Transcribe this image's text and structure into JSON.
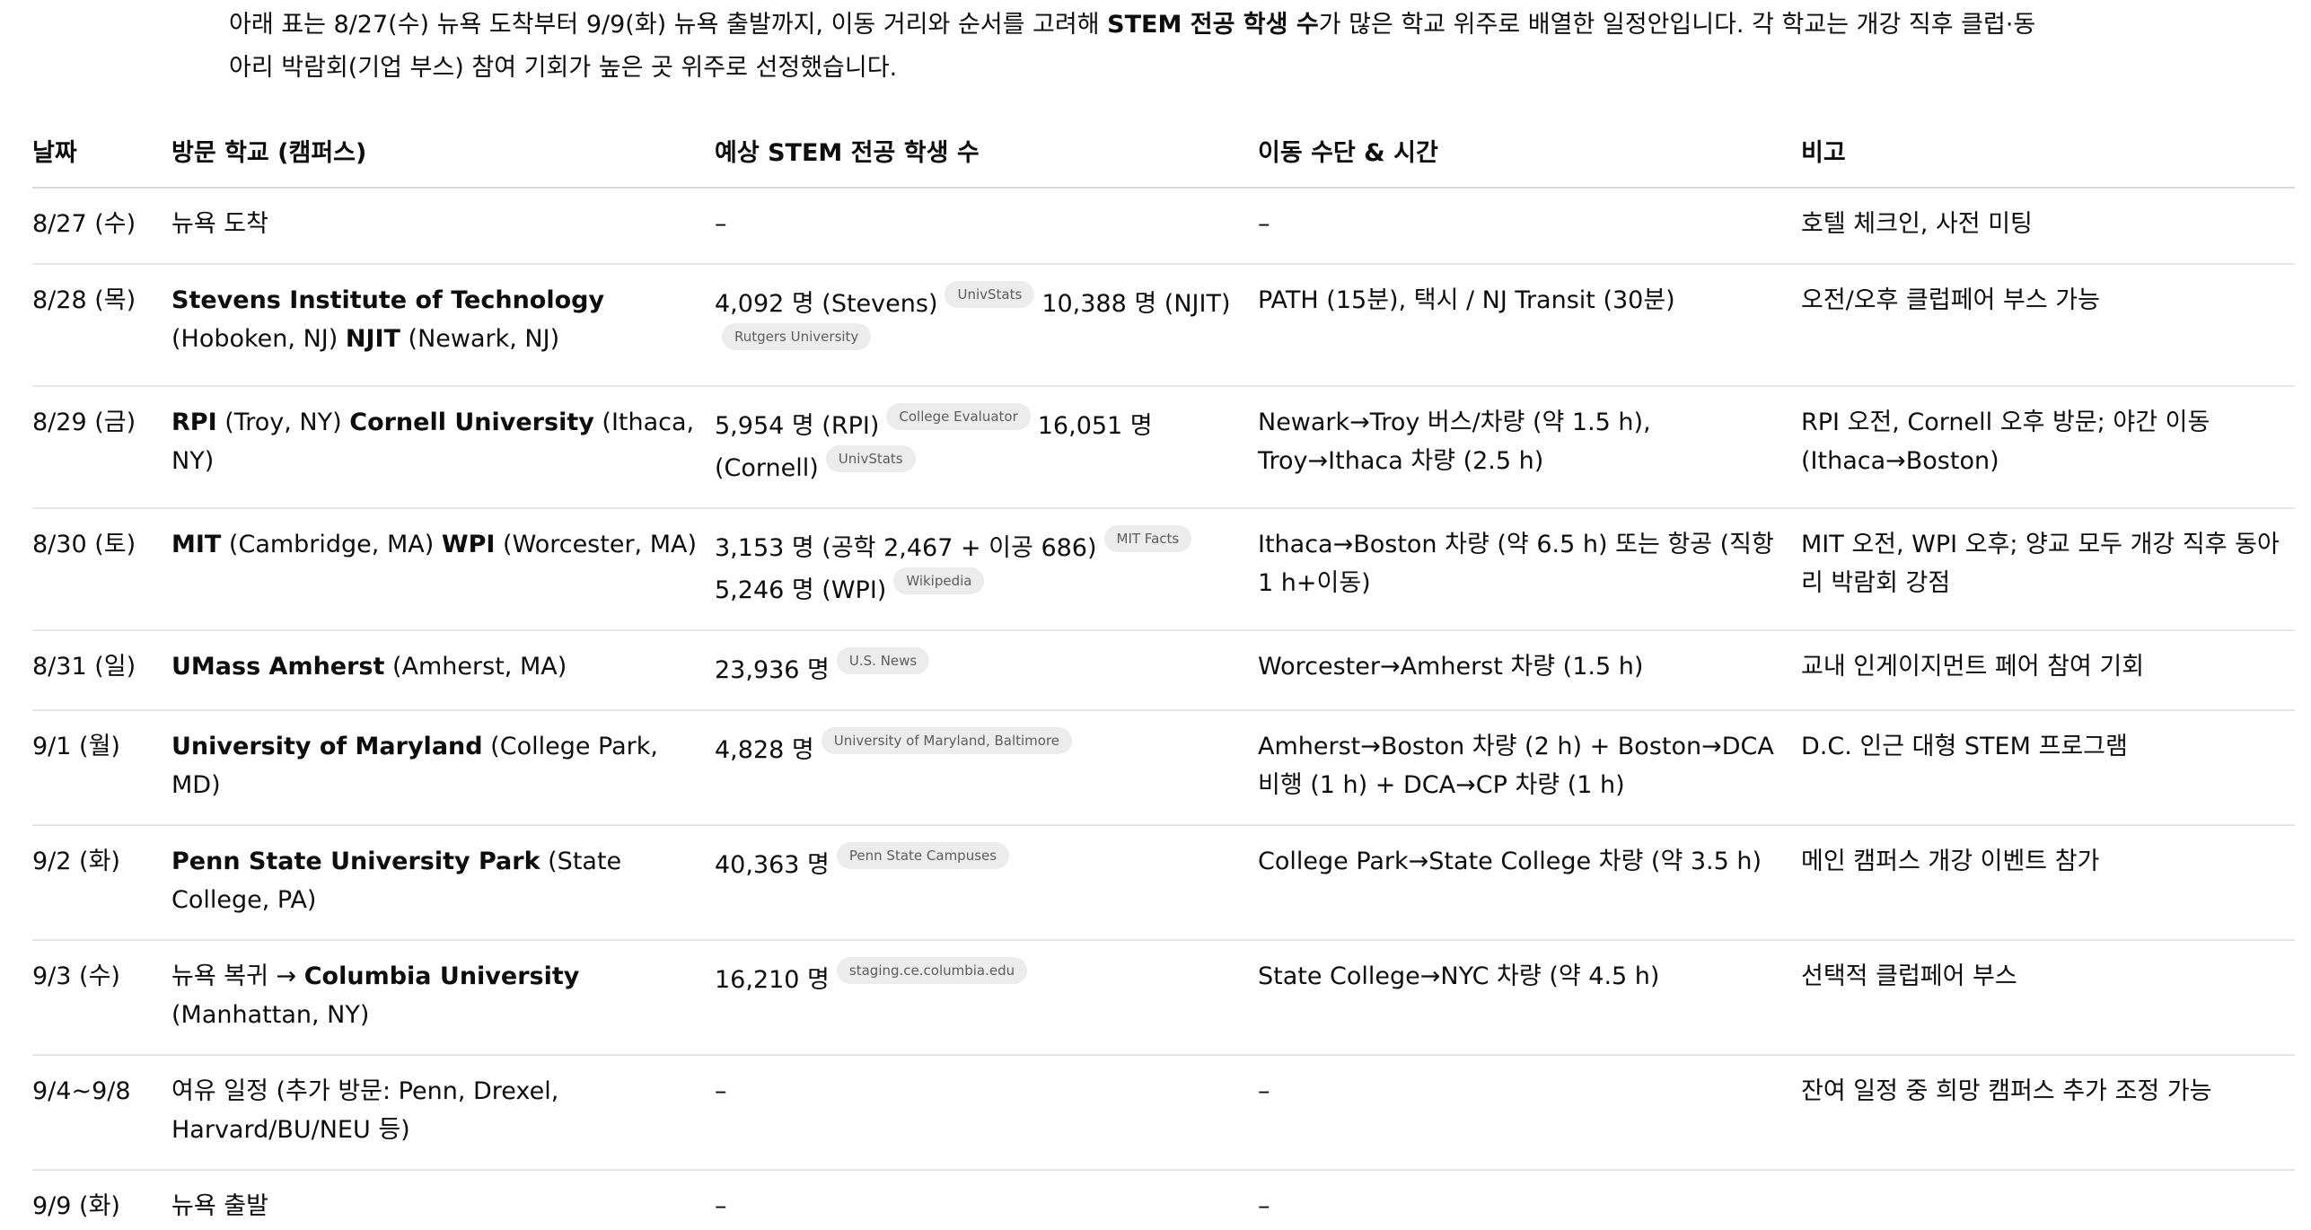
{
  "intro": {
    "p1": "아래 표는 8/27(수) 뉴욕 도착부터 9/9(화) 뉴욕 출발까지, 이동 거리와 순서를 고려해 ",
    "bold": "STEM 전공 학생 수",
    "p2": "가 많은 학교 위주로 배열한 일정안입니다. 각 학교는 개강 직후 클럽·동아리 박람회(기업 부스) 참여 기회가 높은 곳 위주로 선정했습니다."
  },
  "table": {
    "headers": [
      "날짜",
      "방문 학교 (캠퍼스)",
      "예상 STEM 전공 학생 수",
      "이동 수단 & 시간",
      "비고"
    ],
    "rows": [
      {
        "date": "8/27 (수)",
        "school": [
          {
            "plain": "뉴욕 도착"
          }
        ],
        "stem": [
          {
            "plain": "–"
          }
        ],
        "transport": "–",
        "note": "호텔 체크인, 사전 미팅"
      },
      {
        "date": "8/28 (목)",
        "school": [
          {
            "bold": "Stevens Institute of Technology",
            "plain": " (Hoboken, NJ) "
          },
          {
            "bold": "NJIT",
            "plain": " (Newark, NJ)"
          }
        ],
        "stem": [
          {
            "plain": "4,092 명 (Stevens)",
            "chip": "UnivStats"
          },
          {
            "plain": "10,388 명 (NJIT)",
            "chip": "Rutgers University"
          }
        ],
        "transport": "PATH (15분), 택시 / NJ Transit (30분)",
        "note": "오전/오후 클럽페어 부스 가능"
      },
      {
        "date": "8/29 (금)",
        "school": [
          {
            "bold": "RPI",
            "plain": " (Troy, NY) "
          },
          {
            "bold": "Cornell University",
            "plain": " (Ithaca, NY)"
          }
        ],
        "stem": [
          {
            "plain": "5,954 명 (RPI)",
            "chip": "College Evaluator"
          },
          {
            "plain": "16,051 명 (Cornell)",
            "chip": "UnivStats"
          }
        ],
        "transport": "Newark→Troy 버스/차량 (약 1.5 h), Troy→Ithaca 차량 (2.5 h)",
        "note": "RPI 오전, Cornell 오후 방문; 야간 이동 (Ithaca→Boston)"
      },
      {
        "date": "8/30 (토)",
        "school": [
          {
            "bold": "MIT",
            "plain": " (Cambridge, MA) "
          },
          {
            "bold": "WPI",
            "plain": " (Worcester, MA)"
          }
        ],
        "stem": [
          {
            "plain": "3,153 명 (공학 2,467 + 이공 686)",
            "chip": "MIT Facts"
          },
          {
            "plain": "5,246 명 (WPI)",
            "chip": "Wikipedia"
          }
        ],
        "transport": "Ithaca→Boston 차량 (약 6.5 h) 또는 항공 (직항 1 h+이동)",
        "note": "MIT 오전, WPI 오후; 양교 모두 개강 직후 동아리 박람회 강점"
      },
      {
        "date": "8/31 (일)",
        "school": [
          {
            "bold": "UMass Amherst",
            "plain": " (Amherst, MA)"
          }
        ],
        "stem": [
          {
            "plain": "23,936 명",
            "chip": "U.S. News"
          }
        ],
        "transport": "Worcester→Amherst 차량 (1.5 h)",
        "note": "교내 인게이지먼트 페어 참여 기회"
      },
      {
        "date": "9/1 (월)",
        "school": [
          {
            "bold": "University of Maryland",
            "plain": " (College Park, MD)"
          }
        ],
        "stem": [
          {
            "plain": "4,828 명",
            "chip": "University of Maryland, Baltimore"
          }
        ],
        "transport": "Amherst→Boston 차량 (2 h) + Boston→DCA 비행 (1 h) + DCA→CP 차량 (1 h)",
        "note": "D.C. 인근 대형 STEM 프로그램"
      },
      {
        "date": "9/2 (화)",
        "school": [
          {
            "bold": "Penn State University Park",
            "plain": " (State College, PA)"
          }
        ],
        "stem": [
          {
            "plain": "40,363 명",
            "chip": "Penn State Campuses"
          }
        ],
        "transport": "College Park→State College 차량 (약 3.5 h)",
        "note": "메인 캠퍼스 개강 이벤트 참가"
      },
      {
        "date": "9/3 (수)",
        "school": [
          {
            "plain": "뉴욕 복귀 → "
          },
          {
            "bold": "Columbia University",
            "plain": " (Manhattan, NY)"
          }
        ],
        "stem": [
          {
            "plain": "16,210 명",
            "chip": "staging.ce.columbia.edu"
          }
        ],
        "transport": "State College→NYC 차량 (약 4.5 h)",
        "note": "선택적 클럽페어 부스"
      },
      {
        "date": "9/4~9/8",
        "school": [
          {
            "plain": "여유 일정 (추가 방문: Penn, Drexel, Harvard/BU/NEU 등)"
          }
        ],
        "stem": [
          {
            "plain": "–"
          }
        ],
        "transport": "–",
        "note": "잔여 일정 중 희망 캠퍼스 추가 조정 가능"
      },
      {
        "date": "9/9 (화)",
        "school": [
          {
            "plain": "뉴욕 출발"
          }
        ],
        "stem": [
          {
            "plain": "–"
          }
        ],
        "transport": "–",
        "note": ""
      }
    ]
  }
}
